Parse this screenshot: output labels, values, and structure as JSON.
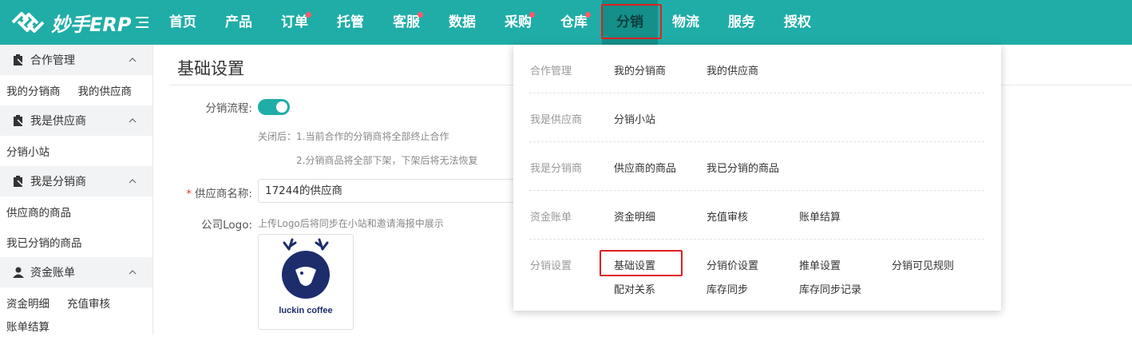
{
  "app": {
    "logo_text": "妙手ERP"
  },
  "nav": {
    "items": [
      {
        "label": "首页",
        "dot": false
      },
      {
        "label": "产品",
        "dot": false
      },
      {
        "label": "订单",
        "dot": true
      },
      {
        "label": "托管",
        "dot": false
      },
      {
        "label": "客服",
        "dot": true
      },
      {
        "label": "数据",
        "dot": false
      },
      {
        "label": "采购",
        "dot": true
      },
      {
        "label": "仓库",
        "dot": true
      },
      {
        "label": "分销",
        "dot": false,
        "active": true
      },
      {
        "label": "物流",
        "dot": false
      },
      {
        "label": "服务",
        "dot": false
      },
      {
        "label": "授权",
        "dot": false
      }
    ]
  },
  "sidebar": {
    "groups": [
      {
        "title": "合作管理",
        "links": [
          "我的分销商",
          "我的供应商"
        ]
      },
      {
        "title": "我是供应商",
        "links": [
          "分销小站"
        ]
      },
      {
        "title": "我是分销商",
        "links": [
          "供应商的商品",
          "我已分销的商品"
        ]
      },
      {
        "title": "资金账单",
        "links": [
          "资金明细",
          "充值审核",
          "账单结算"
        ]
      }
    ]
  },
  "main": {
    "title": "基础设置",
    "flow_label": "分销流程:",
    "flow_enabled": true,
    "hint1": "关闭后：1.当前合作的分销商将全部终止合作",
    "hint2": "2.分销商品将全部下架，下架后将无法恢复",
    "supplier_required_mark": "*",
    "supplier_label": "供应商名称:",
    "supplier_value": "17244的供应商",
    "logo_label": "公司Logo:",
    "logo_hint": "上传Logo后将同步在小站和邀请海报中展示",
    "logo_brand_text": "luckin coffee"
  },
  "dropdown": {
    "rows": [
      {
        "category": "合作管理",
        "links": [
          "我的分销商",
          "我的供应商"
        ]
      },
      {
        "category": "我是供应商",
        "links": [
          "分销小站"
        ]
      },
      {
        "category": "我是分销商",
        "links": [
          "供应商的商品",
          "我已分销的商品"
        ]
      },
      {
        "category": "资金账单",
        "links": [
          "资金明细",
          "充值审核",
          "账单结算"
        ]
      },
      {
        "category": "分销设置",
        "links": [
          "基础设置",
          "分销价设置",
          "推单设置",
          "分销可见规则",
          "配对关系",
          "库存同步",
          "库存同步记录"
        ]
      }
    ]
  },
  "colors": {
    "brand": "#20ada7",
    "active_nav": "#148f8a",
    "highlight": "#e02020",
    "badge": "#ff5a6a",
    "luckin_blue": "#1d2c6b"
  }
}
